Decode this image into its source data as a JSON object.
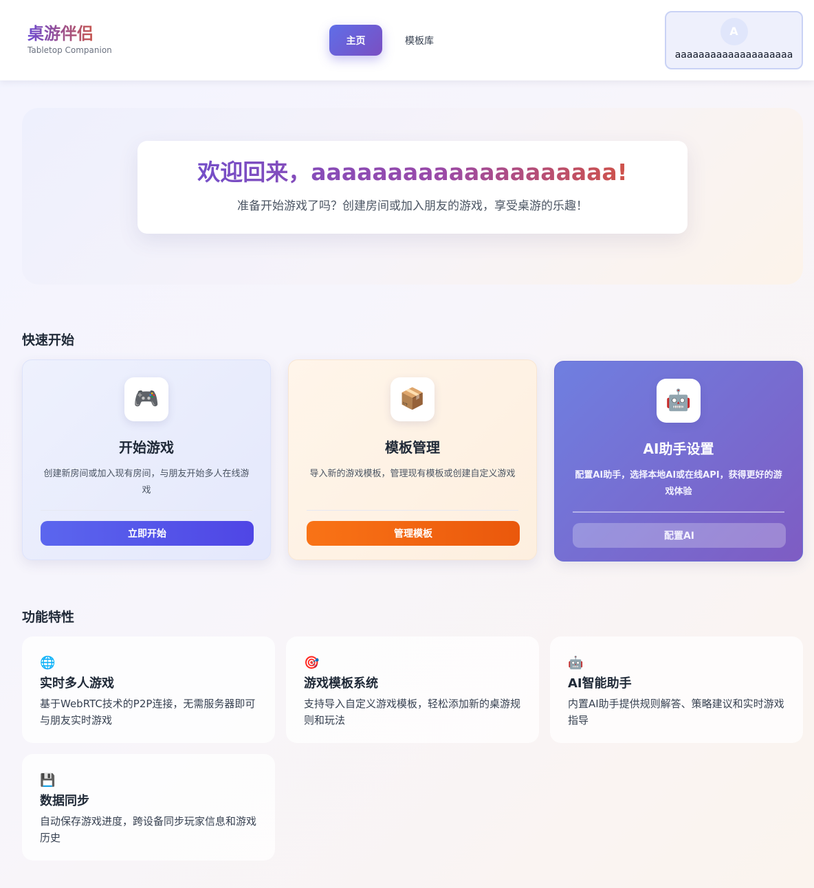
{
  "header": {
    "logo_title": "桌游伴侣",
    "logo_subtitle": "Tabletop Companion",
    "nav": {
      "home": "主页",
      "templates": "模板库"
    },
    "user": {
      "avatar_letter": "A",
      "name": "aaaaaaaaaaaaaaaaaaaa"
    }
  },
  "hero": {
    "title": "欢迎回来，aaaaaaaaaaaaaaaaaaaa!",
    "subtitle": "准备开始游戏了吗？创建房间或加入朋友的游戏，享受桌游的乐趣！"
  },
  "quick_start": {
    "heading": "快速开始",
    "cards": [
      {
        "icon": "🎮",
        "icon_name": "gamepad-icon",
        "title": "开始游戏",
        "desc": "创建新房间或加入现有房间，与朋友开始多人在线游戏",
        "button": "立即开始"
      },
      {
        "icon": "📦",
        "icon_name": "package-icon",
        "title": "模板管理",
        "desc": "导入新的游戏模板，管理现有模板或创建自定义游戏",
        "button": "管理模板"
      },
      {
        "icon": "🤖",
        "icon_name": "robot-icon",
        "title": "AI助手设置",
        "desc": "配置AI助手，选择本地AI或在线API，获得更好的游戏体验",
        "button": "配置AI"
      }
    ]
  },
  "features": {
    "heading": "功能特性",
    "items": [
      {
        "icon": "🌐",
        "icon_name": "globe-icon",
        "title": "实时多人游戏",
        "desc": "基于WebRTC技术的P2P连接，无需服务器即可与朋友实时游戏"
      },
      {
        "icon": "🎯",
        "icon_name": "target-icon",
        "title": "游戏模板系统",
        "desc": "支持导入自定义游戏模板，轻松添加新的桌游规则和玩法"
      },
      {
        "icon": "🤖",
        "icon_name": "robot-icon",
        "title": "AI智能助手",
        "desc": "内置AI助手提供规则解答、策略建议和实时游戏指导"
      },
      {
        "icon": "💾",
        "icon_name": "floppy-disk-icon",
        "title": "数据同步",
        "desc": "自动保存游戏进度，跨设备同步玩家信息和游戏历史"
      }
    ]
  }
}
